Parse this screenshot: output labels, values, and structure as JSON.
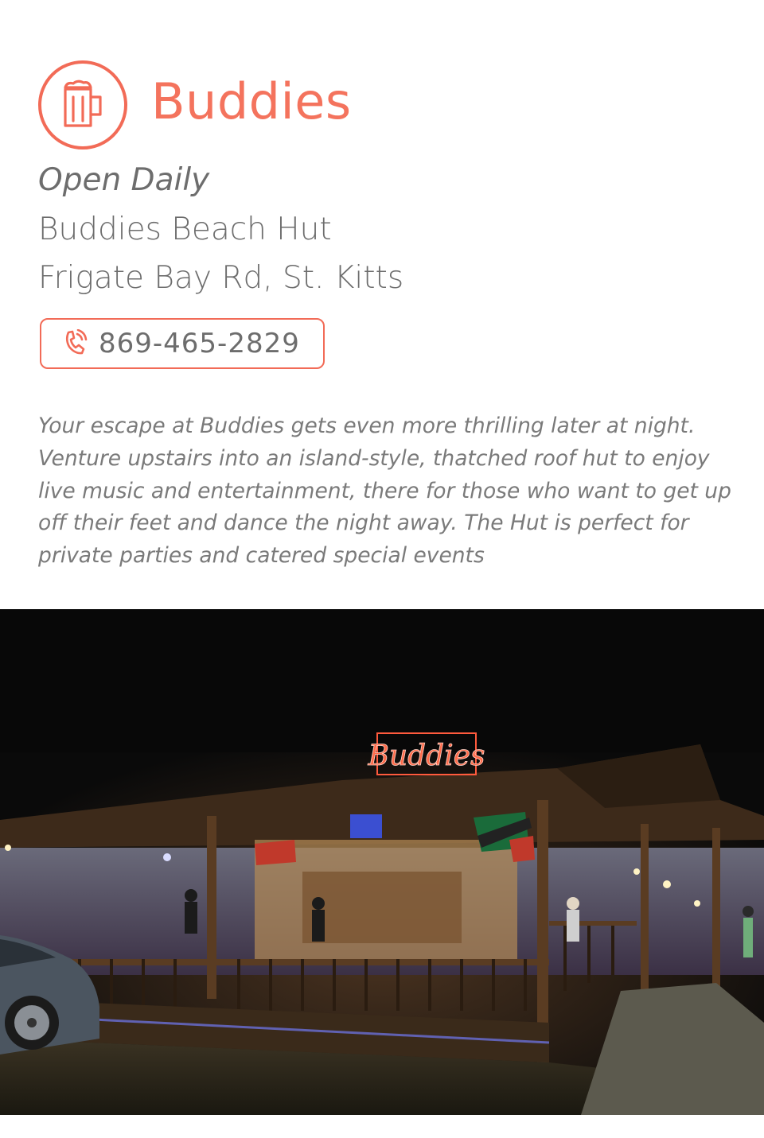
{
  "venue": {
    "name": "Buddies",
    "icon": "beer-mug-icon",
    "hours": "Open Daily",
    "address_line1": "Buddies Beach Hut",
    "address_line2": "Frigate Bay Rd, St. Kitts",
    "phone": "869-465-2829",
    "phone_icon": "phone-icon",
    "description": "Your escape at Buddies gets even more thrilling later at night. Venture upstairs into an island-style, thatched roof hut to enjoy live music and entertainment, there for those who want to get up off their feet and dance the night away. The Hut is perfect for private parties and catered special events"
  },
  "photo": {
    "sign_text": "Buddies"
  },
  "colors": {
    "accent": "#f26b57",
    "text": "#6d6d6d",
    "background": "#ffffff"
  }
}
